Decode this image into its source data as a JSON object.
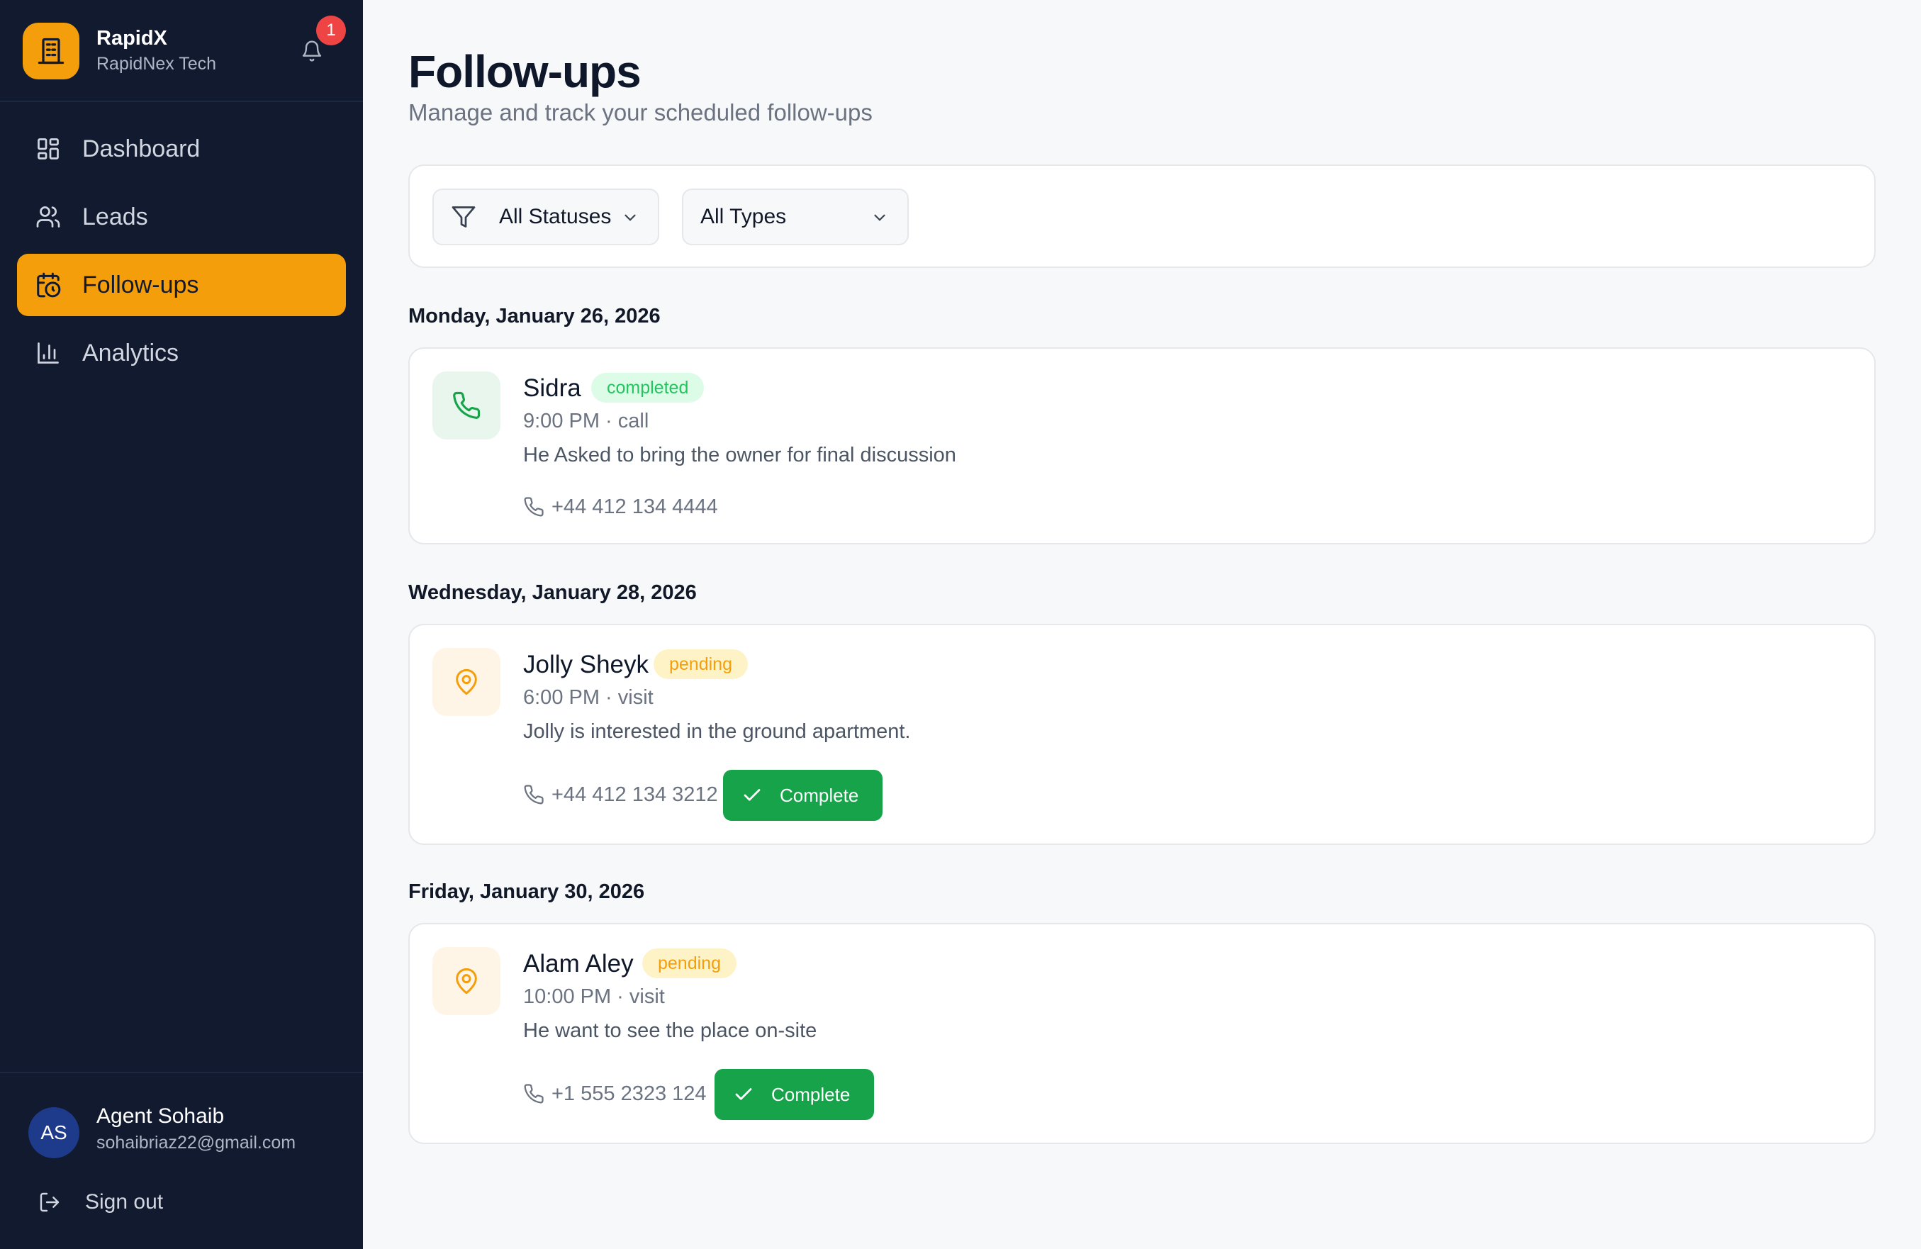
{
  "brand": {
    "name": "RapidX",
    "subtitle": "RapidNex Tech",
    "notification_count": "1"
  },
  "nav": {
    "items": [
      {
        "label": "Dashboard",
        "icon": "grid-icon"
      },
      {
        "label": "Leads",
        "icon": "users-icon"
      },
      {
        "label": "Follow-ups",
        "icon": "calendar-clock-icon",
        "active": true
      },
      {
        "label": "Analytics",
        "icon": "bar-chart-icon"
      }
    ]
  },
  "user": {
    "initials": "AS",
    "name": "Agent Sohaib",
    "email": "sohaibriaz22@gmail.com",
    "signout_label": "Sign out"
  },
  "page": {
    "title": "Follow-ups",
    "subtitle": "Manage and track your scheduled follow-ups"
  },
  "filters": {
    "status": "All Statuses",
    "type": "All Types"
  },
  "groups": [
    {
      "date": "Monday, January 26, 2026",
      "item": {
        "name": "Sidra",
        "status": "completed",
        "time": "9:00 PM · call",
        "note": "He Asked to bring the owner for final discussion",
        "phone": "+44 412 134 4444",
        "icon": "phone-icon"
      }
    },
    {
      "date": "Wednesday, January 28, 2026",
      "item": {
        "name": "Jolly Sheyk",
        "status": "pending",
        "time": "6:00 PM · visit",
        "note": "Jolly is interested in the ground apartment.",
        "phone": "+44 412 134 3212",
        "action": "Complete",
        "icon": "map-pin-icon"
      }
    },
    {
      "date": "Friday, January 30, 2026",
      "item": {
        "name": "Alam Aley",
        "status": "pending",
        "time": "10:00 PM · visit",
        "note": "He want to see the place on-site",
        "phone": "+1 555 2323 124",
        "action": "Complete",
        "icon": "map-pin-icon"
      }
    }
  ],
  "colors": {
    "sidebar": "#111a2e",
    "accent": "#f59e0b",
    "success": "#16a34a",
    "danger": "#ef4444"
  }
}
